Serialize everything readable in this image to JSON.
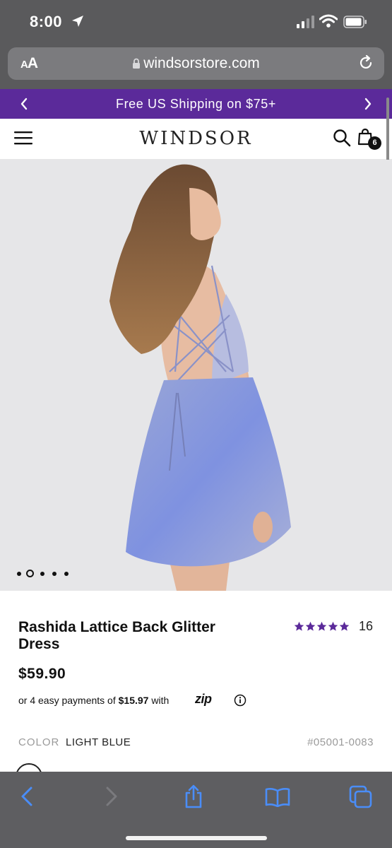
{
  "status_bar": {
    "time": "8:00",
    "icons": [
      "location-arrow-icon",
      "cellular-signal-icon",
      "wifi-icon",
      "battery-icon"
    ]
  },
  "browser": {
    "text_size_big": "A",
    "text_size_small": "A",
    "url": "windsorstore.com",
    "icons": [
      "lock-icon",
      "reload-icon"
    ]
  },
  "promo": {
    "text": "Free US Shipping on $75+",
    "background": "#5b2a9a"
  },
  "header": {
    "logo": "WINDSOR",
    "cart_count": "6",
    "icons": [
      "menu-icon",
      "search-icon",
      "shopping-bag-icon"
    ]
  },
  "gallery": {
    "image_alt": "Model wearing light blue glitter dress with lattice back",
    "slide_count": 5,
    "active_slide": 2
  },
  "product": {
    "title": "Rashida Lattice Back Glitter Dress",
    "rating_stars": 5,
    "review_count": "16",
    "star_color": "#5b2a9a",
    "price": "$59.90",
    "installments_prefix": "or 4 easy payments of",
    "installments_amount": "$15.97",
    "installments_suffix": "with",
    "zip_logo": "zip",
    "color_label": "COLOR",
    "color_value": "LIGHT BLUE",
    "sku": "#05001-0083"
  },
  "toolbar": {
    "icons": [
      "back-icon",
      "forward-icon",
      "share-icon",
      "bookmarks-icon",
      "tabs-icon"
    ],
    "accent": "#4a8df8"
  }
}
